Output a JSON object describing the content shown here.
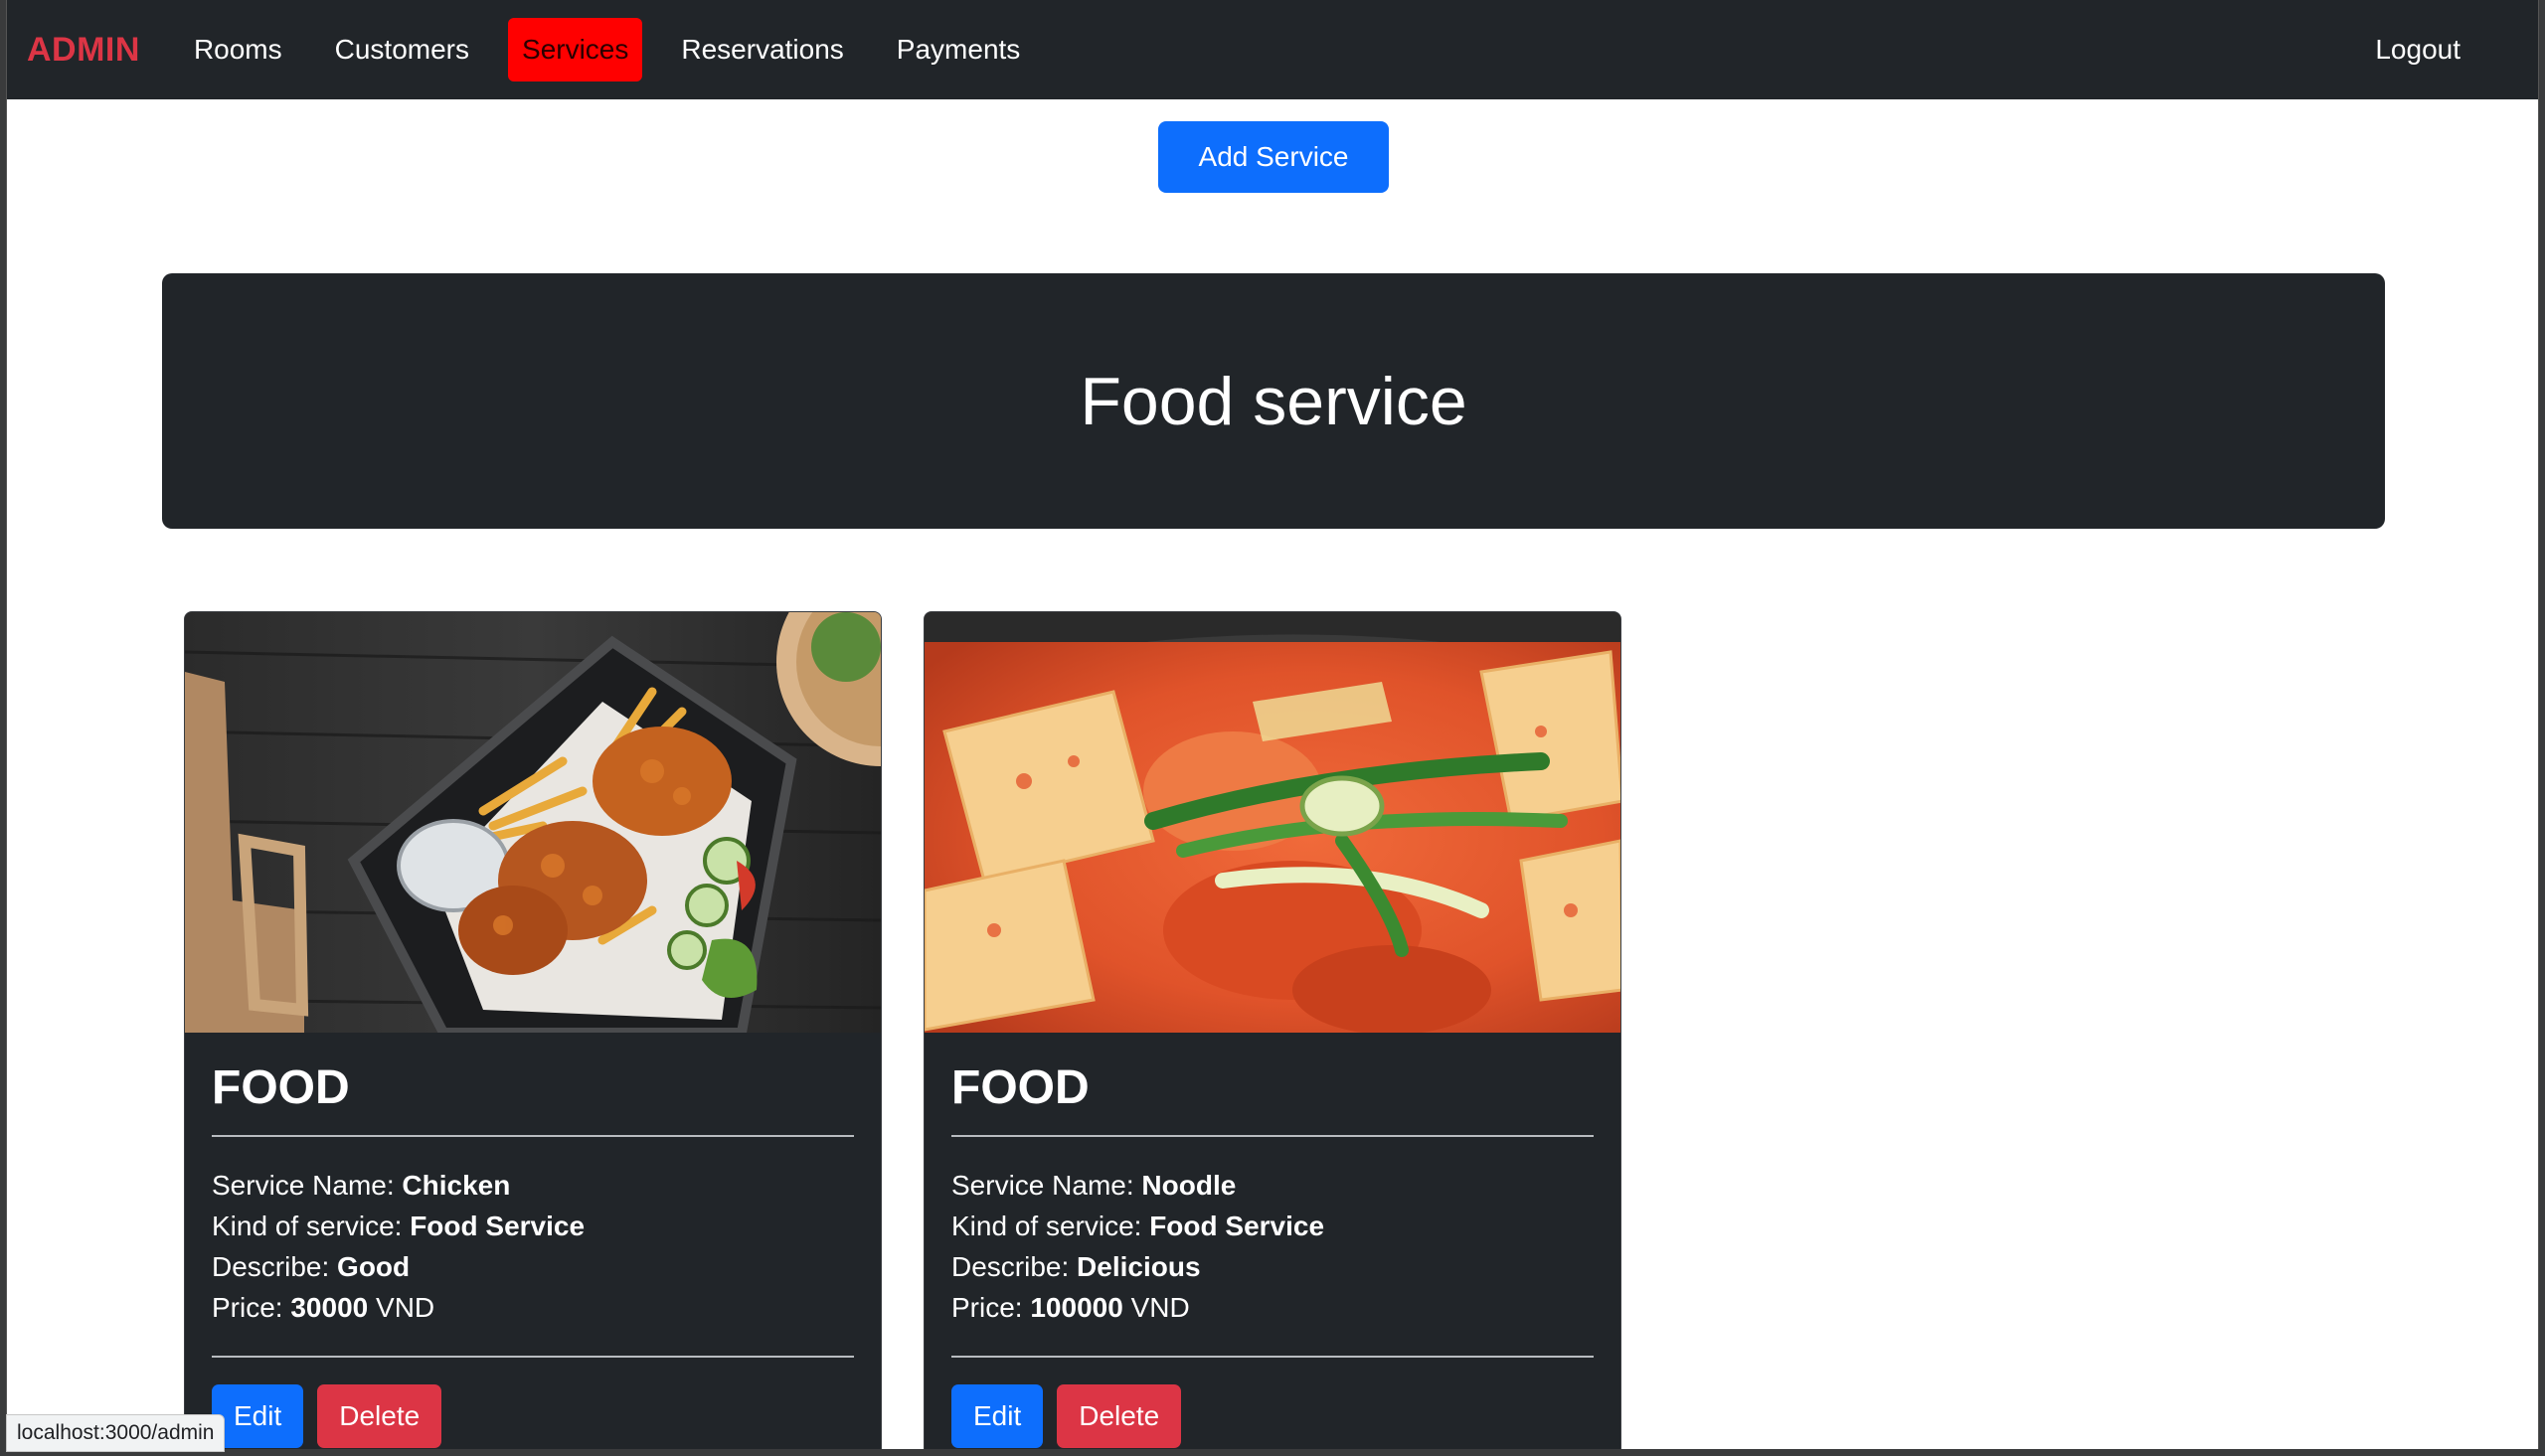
{
  "nav": {
    "brand": "ADMIN",
    "links": [
      {
        "label": "Rooms"
      },
      {
        "label": "Customers"
      },
      {
        "label": "Services"
      },
      {
        "label": "Reservations"
      },
      {
        "label": "Payments"
      }
    ],
    "logout": "Logout",
    "colors": {
      "brand": "#dc3545",
      "active": "#ff0000",
      "bg": "#212529"
    }
  },
  "toolbar": {
    "add_label": "Add Service"
  },
  "hero": {
    "title": "Food service"
  },
  "labels": {
    "service_name": "Service Name:",
    "kind": "Kind of service:",
    "describe": "Describe:",
    "price": "Price:",
    "currency": "VND"
  },
  "cards": [
    {
      "title": "FOOD",
      "service_name": "Chicken",
      "kind": "Food Service",
      "describe": "Good",
      "price": "30000",
      "edit_label": "Edit",
      "delete_label": "Delete"
    },
    {
      "title": "FOOD",
      "service_name": "Noodle",
      "kind": "Food Service",
      "describe": "Delicious",
      "price": "100000",
      "edit_label": "Edit",
      "delete_label": "Delete"
    }
  ],
  "status_bar": {
    "url": "localhost:3000/admin"
  },
  "colors": {
    "primary": "#0d6efd",
    "danger": "#dc3545",
    "dark": "#212529"
  }
}
